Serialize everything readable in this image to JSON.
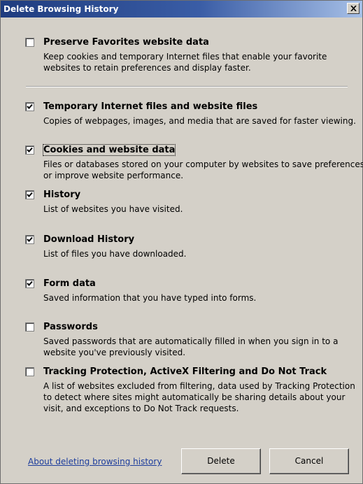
{
  "window": {
    "title": "Delete Browsing History"
  },
  "options": [
    {
      "label": "Preserve Favorites website data",
      "checked": false,
      "description": "Keep cookies and temporary Internet files that enable your favorite websites to retain preferences and display faster."
    },
    {
      "label": "Temporary Internet files and website files",
      "checked": true,
      "description": "Copies of webpages, images, and media that are saved for faster viewing."
    },
    {
      "label": "Cookies and website data",
      "checked": true,
      "description": "Files or databases stored on your computer by websites to save preferences or improve website performance."
    },
    {
      "label": "History",
      "checked": true,
      "description": "List of websites you have visited."
    },
    {
      "label": "Download History",
      "checked": true,
      "description": "List of files you have downloaded."
    },
    {
      "label": "Form data",
      "checked": true,
      "description": "Saved information that you have typed into forms."
    },
    {
      "label": "Passwords",
      "checked": false,
      "description": "Saved passwords that are automatically filled in when you sign in to a website you've previously visited."
    },
    {
      "label": "Tracking Protection, ActiveX Filtering and Do Not Track",
      "checked": false,
      "description": "A list of websites excluded from filtering, data used by Tracking Protection to detect where sites might automatically be sharing details about your visit, and exceptions to Do Not Track requests."
    }
  ],
  "footer": {
    "about_link": "About deleting browsing history",
    "delete_label": "Delete",
    "cancel_label": "Cancel"
  }
}
